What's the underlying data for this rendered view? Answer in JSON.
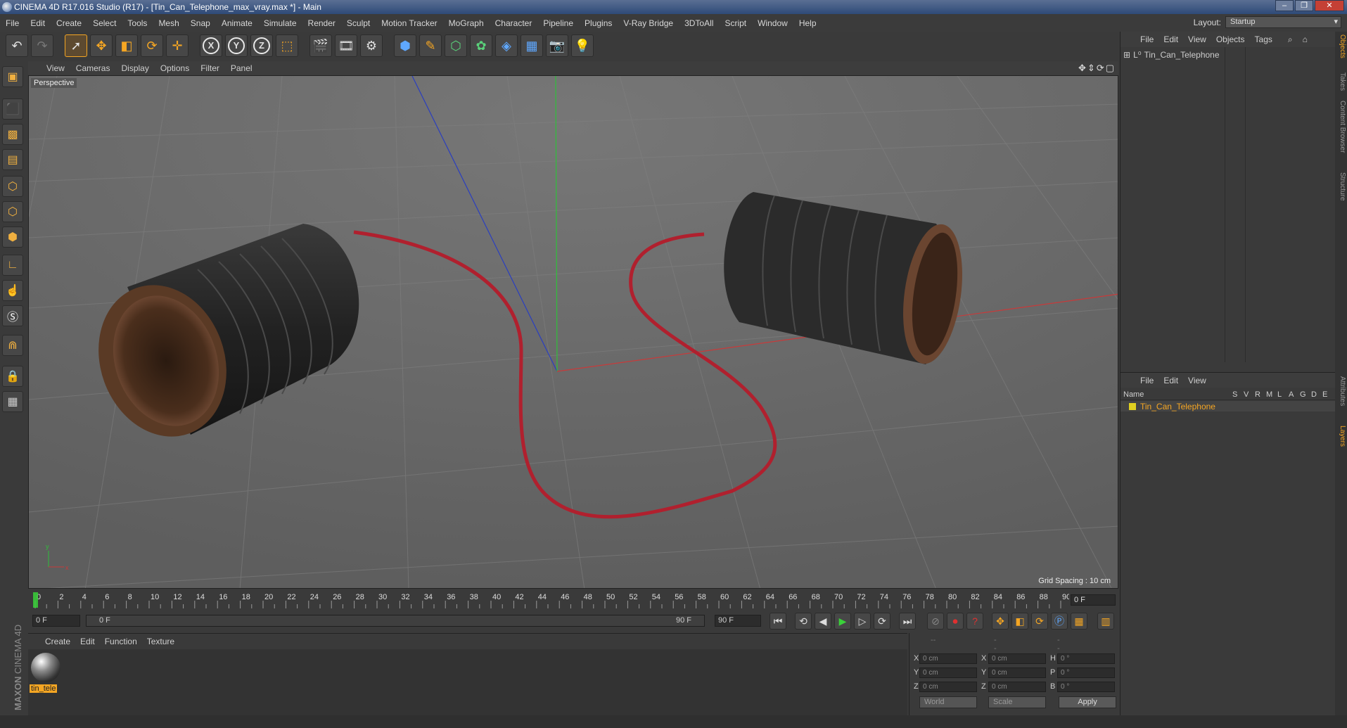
{
  "window": {
    "title": "CINEMA 4D R17.016 Studio (R17) - [Tin_Can_Telephone_max_vray.max *] - Main"
  },
  "menu": [
    "File",
    "Edit",
    "Create",
    "Select",
    "Tools",
    "Mesh",
    "Snap",
    "Animate",
    "Simulate",
    "Render",
    "Sculpt",
    "Motion Tracker",
    "MoGraph",
    "Character",
    "Pipeline",
    "Plugins",
    "V-Ray Bridge",
    "3DToAll",
    "Script",
    "Window",
    "Help"
  ],
  "layout": {
    "label": "Layout:",
    "value": "Startup"
  },
  "toolbar": {
    "x": "X",
    "y": "Y",
    "z": "Z"
  },
  "viewport": {
    "menu": [
      "View",
      "Cameras",
      "Display",
      "Options",
      "Filter",
      "Panel"
    ],
    "label": "Perspective",
    "grid_spacing": "Grid Spacing : 10 cm"
  },
  "timeline": {
    "ticks": [
      "0",
      "2",
      "4",
      "6",
      "8",
      "10",
      "12",
      "14",
      "16",
      "18",
      "20",
      "22",
      "24",
      "26",
      "28",
      "30",
      "32",
      "34",
      "36",
      "38",
      "40",
      "42",
      "44",
      "46",
      "48",
      "50",
      "52",
      "54",
      "56",
      "58",
      "60",
      "62",
      "64",
      "66",
      "68",
      "70",
      "72",
      "74",
      "76",
      "78",
      "80",
      "82",
      "84",
      "86",
      "88",
      "90"
    ],
    "current_frame": "0 F"
  },
  "playback": {
    "start": "0 F",
    "range_start": "0 F",
    "range_end": "90 F",
    "end": "90 F"
  },
  "material_panel": {
    "menu": [
      "Create",
      "Edit",
      "Function",
      "Texture"
    ],
    "material_name": "tin_tele"
  },
  "coords": {
    "rows": [
      {
        "a": "X",
        "av": "0 cm",
        "b": "X",
        "bv": "0 cm",
        "c": "H",
        "cv": "0 °"
      },
      {
        "a": "Y",
        "av": "0 cm",
        "b": "Y",
        "bv": "0 cm",
        "c": "P",
        "cv": "0 °"
      },
      {
        "a": "Z",
        "av": "0 cm",
        "b": "Z",
        "bv": "0 cm",
        "c": "B",
        "cv": "0 °"
      }
    ],
    "mode1": "World",
    "mode2": "Scale",
    "apply": "Apply",
    "header": [
      "--",
      "--",
      "--"
    ]
  },
  "objects_panel": {
    "menu": [
      "File",
      "Edit",
      "View",
      "Objects",
      "Tags"
    ],
    "object": "Tin_Can_Telephone"
  },
  "layers_panel": {
    "menu": [
      "File",
      "Edit",
      "View"
    ],
    "header": {
      "name": "Name",
      "flags": [
        "S",
        "V",
        "R",
        "M",
        "L",
        "A",
        "G",
        "D",
        "E"
      ]
    },
    "layer": "Tin_Can_Telephone"
  },
  "right_tabs": [
    "Objects",
    "Takes",
    "Content Browser",
    "Structure",
    "Attributes",
    "Layers"
  ],
  "branding": {
    "maxon": "MAXON",
    "product": "CINEMA 4D"
  },
  "colors": {
    "accent": "#f5a623",
    "viewport_bg": "#6b6b6b",
    "rope": "#b0202e",
    "can": "#2a2a2a"
  }
}
